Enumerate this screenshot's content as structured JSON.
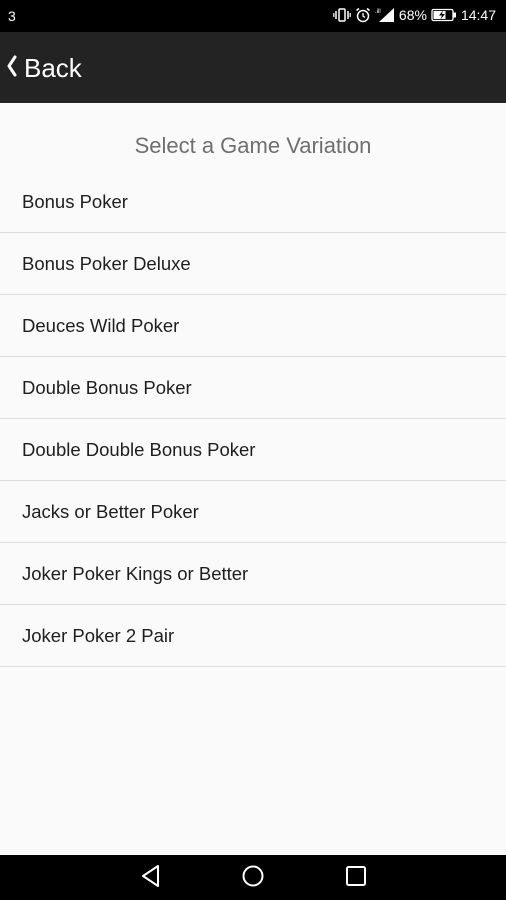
{
  "status_bar": {
    "notification_count": "3",
    "battery_percent": "68%",
    "time": "14:47",
    "icons": [
      "vibrate-icon",
      "alarm-icon",
      "signal-icon",
      "battery-charging-icon"
    ]
  },
  "toolbar": {
    "back_label": "Back",
    "back_icon": "chevron-left-icon"
  },
  "main": {
    "title": "Select a Game Variation",
    "items": [
      {
        "label": "Bonus Poker"
      },
      {
        "label": "Bonus Poker Deluxe"
      },
      {
        "label": "Deuces Wild Poker"
      },
      {
        "label": "Double Bonus Poker"
      },
      {
        "label": "Double Double Bonus Poker"
      },
      {
        "label": "Jacks or Better Poker"
      },
      {
        "label": "Joker Poker Kings or Better"
      },
      {
        "label": "Joker Poker 2 Pair"
      }
    ]
  },
  "nav_bar": {
    "icons": [
      "nav-back-icon",
      "nav-home-icon",
      "nav-recents-icon"
    ]
  },
  "colors": {
    "status_bar": "#000000",
    "toolbar": "#232323",
    "background": "#fafafa",
    "divider": "#dddddd",
    "title_text": "#6f6f6f",
    "item_text": "#1e1e1e"
  }
}
